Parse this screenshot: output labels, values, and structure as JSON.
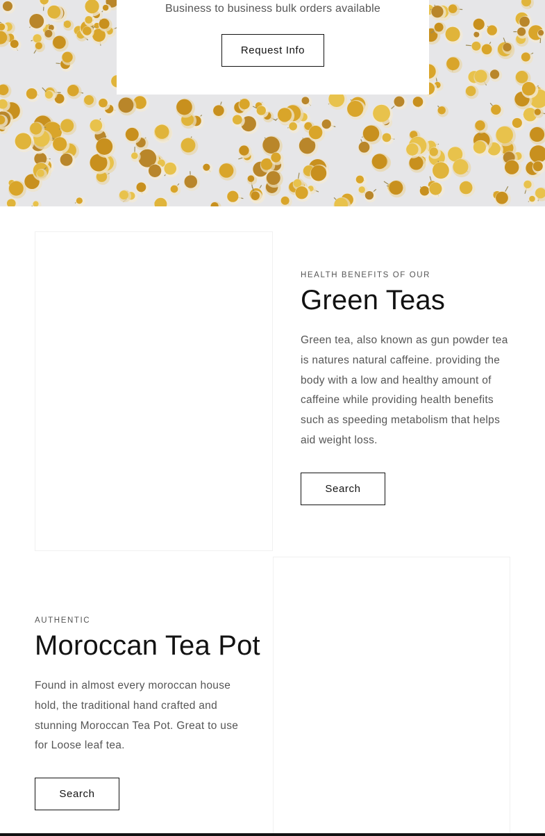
{
  "hero": {
    "subtitle": "Business to business bulk orders available",
    "button_label": "Request Info"
  },
  "green_teas": {
    "eyebrow": "HEALTH BENEFITS OF OUR",
    "title": "Green Teas",
    "body": "Green tea, also known as gun powder tea is natures natural caffeine. providing the body with a low and healthy amount of caffeine while providing health benefits such as speeding metabolism that helps aid weight loss.",
    "button_label": "Search"
  },
  "tea_pot": {
    "eyebrow": "AUTHENTIC",
    "title": "Moroccan Tea Pot",
    "body": "Found in almost every moroccan house hold, the traditional hand crafted and stunning Moroccan Tea Pot. Great to use for Loose leaf tea.",
    "button_label": "Search"
  },
  "colors": {
    "text": "#121212",
    "muted": "#555555",
    "border": "#121212",
    "hero_bg": "#e6e6e8",
    "flower_yellow": "#d9a52a"
  }
}
